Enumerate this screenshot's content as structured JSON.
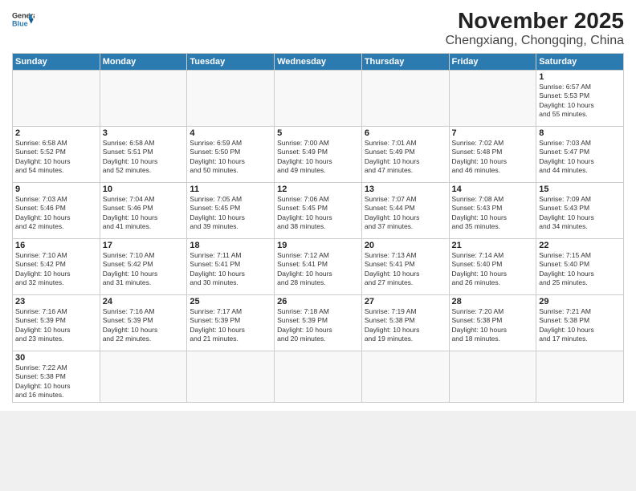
{
  "header": {
    "logo_general": "General",
    "logo_blue": "Blue",
    "month": "November 2025",
    "location": "Chengxiang, Chongqing, China"
  },
  "weekdays": [
    "Sunday",
    "Monday",
    "Tuesday",
    "Wednesday",
    "Thursday",
    "Friday",
    "Saturday"
  ],
  "weeks": [
    [
      {
        "day": "",
        "info": ""
      },
      {
        "day": "",
        "info": ""
      },
      {
        "day": "",
        "info": ""
      },
      {
        "day": "",
        "info": ""
      },
      {
        "day": "",
        "info": ""
      },
      {
        "day": "",
        "info": ""
      },
      {
        "day": "1",
        "info": "Sunrise: 6:57 AM\nSunset: 5:53 PM\nDaylight: 10 hours\nand 55 minutes."
      }
    ],
    [
      {
        "day": "2",
        "info": "Sunrise: 6:58 AM\nSunset: 5:52 PM\nDaylight: 10 hours\nand 54 minutes."
      },
      {
        "day": "3",
        "info": "Sunrise: 6:58 AM\nSunset: 5:51 PM\nDaylight: 10 hours\nand 52 minutes."
      },
      {
        "day": "4",
        "info": "Sunrise: 6:59 AM\nSunset: 5:50 PM\nDaylight: 10 hours\nand 50 minutes."
      },
      {
        "day": "5",
        "info": "Sunrise: 7:00 AM\nSunset: 5:49 PM\nDaylight: 10 hours\nand 49 minutes."
      },
      {
        "day": "6",
        "info": "Sunrise: 7:01 AM\nSunset: 5:49 PM\nDaylight: 10 hours\nand 47 minutes."
      },
      {
        "day": "7",
        "info": "Sunrise: 7:02 AM\nSunset: 5:48 PM\nDaylight: 10 hours\nand 46 minutes."
      },
      {
        "day": "8",
        "info": "Sunrise: 7:03 AM\nSunset: 5:47 PM\nDaylight: 10 hours\nand 44 minutes."
      }
    ],
    [
      {
        "day": "9",
        "info": "Sunrise: 7:03 AM\nSunset: 5:46 PM\nDaylight: 10 hours\nand 42 minutes."
      },
      {
        "day": "10",
        "info": "Sunrise: 7:04 AM\nSunset: 5:46 PM\nDaylight: 10 hours\nand 41 minutes."
      },
      {
        "day": "11",
        "info": "Sunrise: 7:05 AM\nSunset: 5:45 PM\nDaylight: 10 hours\nand 39 minutes."
      },
      {
        "day": "12",
        "info": "Sunrise: 7:06 AM\nSunset: 5:45 PM\nDaylight: 10 hours\nand 38 minutes."
      },
      {
        "day": "13",
        "info": "Sunrise: 7:07 AM\nSunset: 5:44 PM\nDaylight: 10 hours\nand 37 minutes."
      },
      {
        "day": "14",
        "info": "Sunrise: 7:08 AM\nSunset: 5:43 PM\nDaylight: 10 hours\nand 35 minutes."
      },
      {
        "day": "15",
        "info": "Sunrise: 7:09 AM\nSunset: 5:43 PM\nDaylight: 10 hours\nand 34 minutes."
      }
    ],
    [
      {
        "day": "16",
        "info": "Sunrise: 7:10 AM\nSunset: 5:42 PM\nDaylight: 10 hours\nand 32 minutes."
      },
      {
        "day": "17",
        "info": "Sunrise: 7:10 AM\nSunset: 5:42 PM\nDaylight: 10 hours\nand 31 minutes."
      },
      {
        "day": "18",
        "info": "Sunrise: 7:11 AM\nSunset: 5:41 PM\nDaylight: 10 hours\nand 30 minutes."
      },
      {
        "day": "19",
        "info": "Sunrise: 7:12 AM\nSunset: 5:41 PM\nDaylight: 10 hours\nand 28 minutes."
      },
      {
        "day": "20",
        "info": "Sunrise: 7:13 AM\nSunset: 5:41 PM\nDaylight: 10 hours\nand 27 minutes."
      },
      {
        "day": "21",
        "info": "Sunrise: 7:14 AM\nSunset: 5:40 PM\nDaylight: 10 hours\nand 26 minutes."
      },
      {
        "day": "22",
        "info": "Sunrise: 7:15 AM\nSunset: 5:40 PM\nDaylight: 10 hours\nand 25 minutes."
      }
    ],
    [
      {
        "day": "23",
        "info": "Sunrise: 7:16 AM\nSunset: 5:39 PM\nDaylight: 10 hours\nand 23 minutes."
      },
      {
        "day": "24",
        "info": "Sunrise: 7:16 AM\nSunset: 5:39 PM\nDaylight: 10 hours\nand 22 minutes."
      },
      {
        "day": "25",
        "info": "Sunrise: 7:17 AM\nSunset: 5:39 PM\nDaylight: 10 hours\nand 21 minutes."
      },
      {
        "day": "26",
        "info": "Sunrise: 7:18 AM\nSunset: 5:39 PM\nDaylight: 10 hours\nand 20 minutes."
      },
      {
        "day": "27",
        "info": "Sunrise: 7:19 AM\nSunset: 5:38 PM\nDaylight: 10 hours\nand 19 minutes."
      },
      {
        "day": "28",
        "info": "Sunrise: 7:20 AM\nSunset: 5:38 PM\nDaylight: 10 hours\nand 18 minutes."
      },
      {
        "day": "29",
        "info": "Sunrise: 7:21 AM\nSunset: 5:38 PM\nDaylight: 10 hours\nand 17 minutes."
      }
    ],
    [
      {
        "day": "30",
        "info": "Sunrise: 7:22 AM\nSunset: 5:38 PM\nDaylight: 10 hours\nand 16 minutes."
      },
      {
        "day": "",
        "info": ""
      },
      {
        "day": "",
        "info": ""
      },
      {
        "day": "",
        "info": ""
      },
      {
        "day": "",
        "info": ""
      },
      {
        "day": "",
        "info": ""
      },
      {
        "day": "",
        "info": ""
      }
    ]
  ]
}
